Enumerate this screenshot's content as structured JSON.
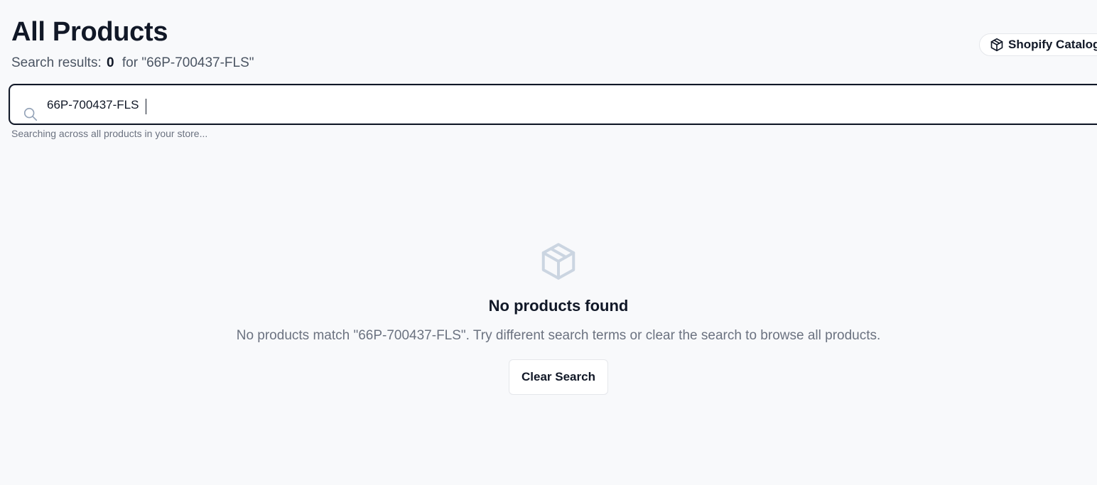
{
  "header": {
    "title": "All Products",
    "results_label": "Search results:",
    "results_count": "0",
    "results_query": "for \"66P-700437-FLS\""
  },
  "catalog_badge": {
    "label": "Shopify Catalog",
    "icon": "package-icon"
  },
  "search": {
    "value": "66P-700437-FLS",
    "placeholder": "",
    "icon": "search-icon",
    "hint": "Searching across all products in your store..."
  },
  "empty_state": {
    "icon": "package-icon",
    "title": "No products found",
    "description": "No products match \"66P-700437-FLS\". Try different search terms or clear the search to browse all products.",
    "clear_button_label": "Clear Search"
  },
  "colors": {
    "background": "#f8f9fb",
    "text_primary": "#111827",
    "text_muted": "#6b7280",
    "icon_muted": "#cbd5e1"
  }
}
